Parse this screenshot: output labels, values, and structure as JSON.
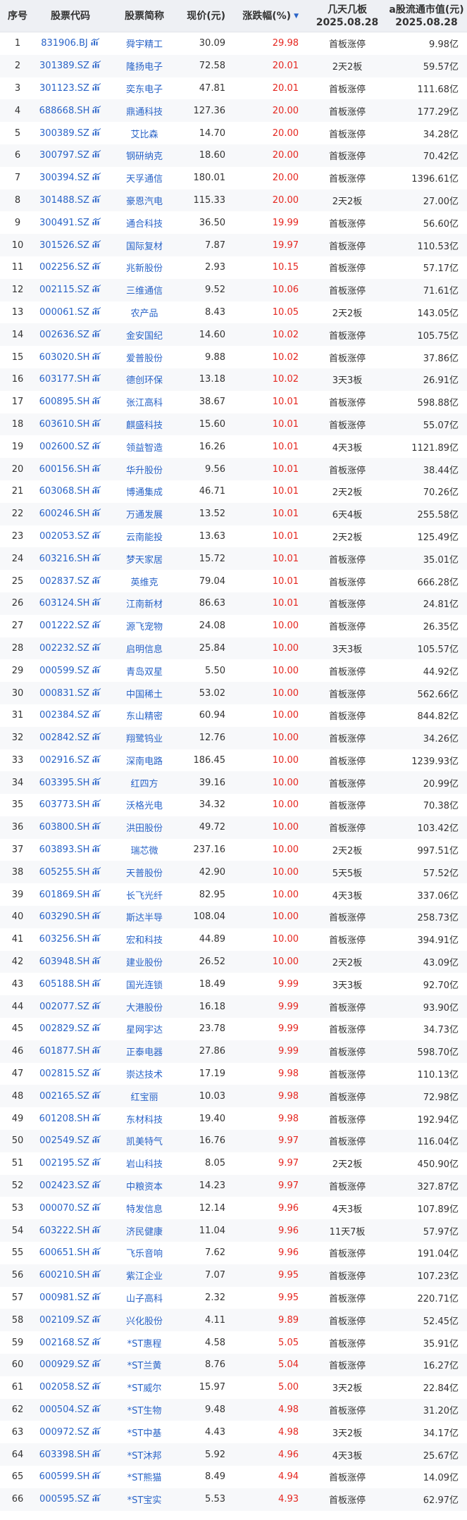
{
  "header": {
    "idx": "序号",
    "code": "股票代码",
    "name": "股票简称",
    "price": "现价(元)",
    "chg": "涨跌幅(%)",
    "streak_line1": "几天几板",
    "streak_line2": "2025.08.28",
    "cap_line1": "a股流通市值(元)",
    "cap_line2": "2025.08.28"
  },
  "colors": {
    "up": "#e5261f",
    "link": "#2a64c8",
    "header_bg": "#eef0f4",
    "stripe_bg": "#f7f8fa"
  },
  "icons": {
    "code_suffix": "mini-chart-icon",
    "sort": "sort-desc-icon"
  },
  "rows": [
    {
      "idx": "1",
      "code": "831906.BJ",
      "name": "舜宇精工",
      "price": "30.09",
      "chg": "29.98",
      "streak": "首板涨停",
      "cap": "9.98亿"
    },
    {
      "idx": "2",
      "code": "301389.SZ",
      "name": "隆扬电子",
      "price": "72.58",
      "chg": "20.01",
      "streak": "2天2板",
      "cap": "59.57亿"
    },
    {
      "idx": "3",
      "code": "301123.SZ",
      "name": "奕东电子",
      "price": "47.81",
      "chg": "20.01",
      "streak": "首板涨停",
      "cap": "111.68亿"
    },
    {
      "idx": "4",
      "code": "688668.SH",
      "name": "鼎通科技",
      "price": "127.36",
      "chg": "20.00",
      "streak": "首板涨停",
      "cap": "177.29亿"
    },
    {
      "idx": "5",
      "code": "300389.SZ",
      "name": "艾比森",
      "price": "14.70",
      "chg": "20.00",
      "streak": "首板涨停",
      "cap": "34.28亿"
    },
    {
      "idx": "6",
      "code": "300797.SZ",
      "name": "钢研纳克",
      "price": "18.60",
      "chg": "20.00",
      "streak": "首板涨停",
      "cap": "70.42亿"
    },
    {
      "idx": "7",
      "code": "300394.SZ",
      "name": "天孚通信",
      "price": "180.01",
      "chg": "20.00",
      "streak": "首板涨停",
      "cap": "1396.61亿"
    },
    {
      "idx": "8",
      "code": "301488.SZ",
      "name": "豪恩汽电",
      "price": "115.33",
      "chg": "20.00",
      "streak": "2天2板",
      "cap": "27.00亿"
    },
    {
      "idx": "9",
      "code": "300491.SZ",
      "name": "通合科技",
      "price": "36.50",
      "chg": "19.99",
      "streak": "首板涨停",
      "cap": "56.60亿"
    },
    {
      "idx": "10",
      "code": "301526.SZ",
      "name": "国际复材",
      "price": "7.87",
      "chg": "19.97",
      "streak": "首板涨停",
      "cap": "110.53亿"
    },
    {
      "idx": "11",
      "code": "002256.SZ",
      "name": "兆新股份",
      "price": "2.93",
      "chg": "10.15",
      "streak": "首板涨停",
      "cap": "57.17亿"
    },
    {
      "idx": "12",
      "code": "002115.SZ",
      "name": "三维通信",
      "price": "9.52",
      "chg": "10.06",
      "streak": "首板涨停",
      "cap": "71.61亿"
    },
    {
      "idx": "13",
      "code": "000061.SZ",
      "name": "农产品",
      "price": "8.43",
      "chg": "10.05",
      "streak": "2天2板",
      "cap": "143.05亿"
    },
    {
      "idx": "14",
      "code": "002636.SZ",
      "name": "金安国纪",
      "price": "14.60",
      "chg": "10.02",
      "streak": "首板涨停",
      "cap": "105.75亿"
    },
    {
      "idx": "15",
      "code": "603020.SH",
      "name": "爱普股份",
      "price": "9.88",
      "chg": "10.02",
      "streak": "首板涨停",
      "cap": "37.86亿"
    },
    {
      "idx": "16",
      "code": "603177.SH",
      "name": "德创环保",
      "price": "13.18",
      "chg": "10.02",
      "streak": "3天3板",
      "cap": "26.91亿"
    },
    {
      "idx": "17",
      "code": "600895.SH",
      "name": "张江高科",
      "price": "38.67",
      "chg": "10.01",
      "streak": "首板涨停",
      "cap": "598.88亿"
    },
    {
      "idx": "18",
      "code": "603610.SH",
      "name": "麒盛科技",
      "price": "15.60",
      "chg": "10.01",
      "streak": "首板涨停",
      "cap": "55.07亿"
    },
    {
      "idx": "19",
      "code": "002600.SZ",
      "name": "领益智造",
      "price": "16.26",
      "chg": "10.01",
      "streak": "4天3板",
      "cap": "1121.89亿"
    },
    {
      "idx": "20",
      "code": "600156.SH",
      "name": "华升股份",
      "price": "9.56",
      "chg": "10.01",
      "streak": "首板涨停",
      "cap": "38.44亿"
    },
    {
      "idx": "21",
      "code": "603068.SH",
      "name": "博通集成",
      "price": "46.71",
      "chg": "10.01",
      "streak": "2天2板",
      "cap": "70.26亿"
    },
    {
      "idx": "22",
      "code": "600246.SH",
      "name": "万通发展",
      "price": "13.52",
      "chg": "10.01",
      "streak": "6天4板",
      "cap": "255.58亿"
    },
    {
      "idx": "23",
      "code": "002053.SZ",
      "name": "云南能投",
      "price": "13.63",
      "chg": "10.01",
      "streak": "2天2板",
      "cap": "125.49亿"
    },
    {
      "idx": "24",
      "code": "603216.SH",
      "name": "梦天家居",
      "price": "15.72",
      "chg": "10.01",
      "streak": "首板涨停",
      "cap": "35.01亿"
    },
    {
      "idx": "25",
      "code": "002837.SZ",
      "name": "英维克",
      "price": "79.04",
      "chg": "10.01",
      "streak": "首板涨停",
      "cap": "666.28亿"
    },
    {
      "idx": "26",
      "code": "603124.SH",
      "name": "江南新材",
      "price": "86.63",
      "chg": "10.01",
      "streak": "首板涨停",
      "cap": "24.81亿"
    },
    {
      "idx": "27",
      "code": "001222.SZ",
      "name": "源飞宠物",
      "price": "24.08",
      "chg": "10.00",
      "streak": "首板涨停",
      "cap": "26.35亿"
    },
    {
      "idx": "28",
      "code": "002232.SZ",
      "name": "启明信息",
      "price": "25.84",
      "chg": "10.00",
      "streak": "3天3板",
      "cap": "105.57亿"
    },
    {
      "idx": "29",
      "code": "000599.SZ",
      "name": "青岛双星",
      "price": "5.50",
      "chg": "10.00",
      "streak": "首板涨停",
      "cap": "44.92亿"
    },
    {
      "idx": "30",
      "code": "000831.SZ",
      "name": "中国稀土",
      "price": "53.02",
      "chg": "10.00",
      "streak": "首板涨停",
      "cap": "562.66亿"
    },
    {
      "idx": "31",
      "code": "002384.SZ",
      "name": "东山精密",
      "price": "60.94",
      "chg": "10.00",
      "streak": "首板涨停",
      "cap": "844.82亿"
    },
    {
      "idx": "32",
      "code": "002842.SZ",
      "name": "翔鹭钨业",
      "price": "12.76",
      "chg": "10.00",
      "streak": "首板涨停",
      "cap": "34.26亿"
    },
    {
      "idx": "33",
      "code": "002916.SZ",
      "name": "深南电路",
      "price": "186.45",
      "chg": "10.00",
      "streak": "首板涨停",
      "cap": "1239.93亿"
    },
    {
      "idx": "34",
      "code": "603395.SH",
      "name": "红四方",
      "price": "39.16",
      "chg": "10.00",
      "streak": "首板涨停",
      "cap": "20.99亿"
    },
    {
      "idx": "35",
      "code": "603773.SH",
      "name": "沃格光电",
      "price": "34.32",
      "chg": "10.00",
      "streak": "首板涨停",
      "cap": "70.38亿"
    },
    {
      "idx": "36",
      "code": "603800.SH",
      "name": "洪田股份",
      "price": "49.72",
      "chg": "10.00",
      "streak": "首板涨停",
      "cap": "103.42亿"
    },
    {
      "idx": "37",
      "code": "603893.SH",
      "name": "瑞芯微",
      "price": "237.16",
      "chg": "10.00",
      "streak": "2天2板",
      "cap": "997.51亿"
    },
    {
      "idx": "38",
      "code": "605255.SH",
      "name": "天普股份",
      "price": "42.90",
      "chg": "10.00",
      "streak": "5天5板",
      "cap": "57.52亿"
    },
    {
      "idx": "39",
      "code": "601869.SH",
      "name": "长飞光纤",
      "price": "82.95",
      "chg": "10.00",
      "streak": "4天3板",
      "cap": "337.06亿"
    },
    {
      "idx": "40",
      "code": "603290.SH",
      "name": "斯达半导",
      "price": "108.04",
      "chg": "10.00",
      "streak": "首板涨停",
      "cap": "258.73亿"
    },
    {
      "idx": "41",
      "code": "603256.SH",
      "name": "宏和科技",
      "price": "44.89",
      "chg": "10.00",
      "streak": "首板涨停",
      "cap": "394.91亿"
    },
    {
      "idx": "42",
      "code": "603948.SH",
      "name": "建业股份",
      "price": "26.52",
      "chg": "10.00",
      "streak": "2天2板",
      "cap": "43.09亿"
    },
    {
      "idx": "43",
      "code": "605188.SH",
      "name": "国光连锁",
      "price": "18.49",
      "chg": "9.99",
      "streak": "3天3板",
      "cap": "92.70亿"
    },
    {
      "idx": "44",
      "code": "002077.SZ",
      "name": "大港股份",
      "price": "16.18",
      "chg": "9.99",
      "streak": "首板涨停",
      "cap": "93.90亿"
    },
    {
      "idx": "45",
      "code": "002829.SZ",
      "name": "星网宇达",
      "price": "23.78",
      "chg": "9.99",
      "streak": "首板涨停",
      "cap": "34.73亿"
    },
    {
      "idx": "46",
      "code": "601877.SH",
      "name": "正泰电器",
      "price": "27.86",
      "chg": "9.99",
      "streak": "首板涨停",
      "cap": "598.70亿"
    },
    {
      "idx": "47",
      "code": "002815.SZ",
      "name": "崇达技术",
      "price": "17.19",
      "chg": "9.98",
      "streak": "首板涨停",
      "cap": "110.13亿"
    },
    {
      "idx": "48",
      "code": "002165.SZ",
      "name": "红宝丽",
      "price": "10.03",
      "chg": "9.98",
      "streak": "首板涨停",
      "cap": "72.98亿"
    },
    {
      "idx": "49",
      "code": "601208.SH",
      "name": "东材科技",
      "price": "19.40",
      "chg": "9.98",
      "streak": "首板涨停",
      "cap": "192.94亿"
    },
    {
      "idx": "50",
      "code": "002549.SZ",
      "name": "凯美特气",
      "price": "16.76",
      "chg": "9.97",
      "streak": "首板涨停",
      "cap": "116.04亿"
    },
    {
      "idx": "51",
      "code": "002195.SZ",
      "name": "岩山科技",
      "price": "8.05",
      "chg": "9.97",
      "streak": "2天2板",
      "cap": "450.90亿"
    },
    {
      "idx": "52",
      "code": "002423.SZ",
      "name": "中粮资本",
      "price": "14.23",
      "chg": "9.97",
      "streak": "首板涨停",
      "cap": "327.87亿"
    },
    {
      "idx": "53",
      "code": "000070.SZ",
      "name": "特发信息",
      "price": "12.14",
      "chg": "9.96",
      "streak": "4天3板",
      "cap": "107.89亿"
    },
    {
      "idx": "54",
      "code": "603222.SH",
      "name": "济民健康",
      "price": "11.04",
      "chg": "9.96",
      "streak": "11天7板",
      "cap": "57.97亿"
    },
    {
      "idx": "55",
      "code": "600651.SH",
      "name": "飞乐音响",
      "price": "7.62",
      "chg": "9.96",
      "streak": "首板涨停",
      "cap": "191.04亿"
    },
    {
      "idx": "56",
      "code": "600210.SH",
      "name": "紫江企业",
      "price": "7.07",
      "chg": "9.95",
      "streak": "首板涨停",
      "cap": "107.23亿"
    },
    {
      "idx": "57",
      "code": "000981.SZ",
      "name": "山子高科",
      "price": "2.32",
      "chg": "9.95",
      "streak": "首板涨停",
      "cap": "220.71亿"
    },
    {
      "idx": "58",
      "code": "002109.SZ",
      "name": "兴化股份",
      "price": "4.11",
      "chg": "9.89",
      "streak": "首板涨停",
      "cap": "52.45亿"
    },
    {
      "idx": "59",
      "code": "002168.SZ",
      "name": "*ST惠程",
      "price": "4.58",
      "chg": "5.05",
      "streak": "首板涨停",
      "cap": "35.91亿"
    },
    {
      "idx": "60",
      "code": "000929.SZ",
      "name": "*ST兰黄",
      "price": "8.76",
      "chg": "5.04",
      "streak": "首板涨停",
      "cap": "16.27亿"
    },
    {
      "idx": "61",
      "code": "002058.SZ",
      "name": "*ST威尔",
      "price": "15.97",
      "chg": "5.00",
      "streak": "3天2板",
      "cap": "22.84亿"
    },
    {
      "idx": "62",
      "code": "000504.SZ",
      "name": "*ST生物",
      "price": "9.48",
      "chg": "4.98",
      "streak": "首板涨停",
      "cap": "31.20亿"
    },
    {
      "idx": "63",
      "code": "000972.SZ",
      "name": "*ST中基",
      "price": "4.43",
      "chg": "4.98",
      "streak": "3天2板",
      "cap": "34.17亿"
    },
    {
      "idx": "64",
      "code": "603398.SH",
      "name": "*ST沐邦",
      "price": "5.92",
      "chg": "4.96",
      "streak": "4天3板",
      "cap": "25.67亿"
    },
    {
      "idx": "65",
      "code": "600599.SH",
      "name": "*ST熊猫",
      "price": "8.49",
      "chg": "4.94",
      "streak": "首板涨停",
      "cap": "14.09亿"
    },
    {
      "idx": "66",
      "code": "000595.SZ",
      "name": "*ST宝实",
      "price": "5.53",
      "chg": "4.93",
      "streak": "首板涨停",
      "cap": "62.97亿"
    }
  ]
}
